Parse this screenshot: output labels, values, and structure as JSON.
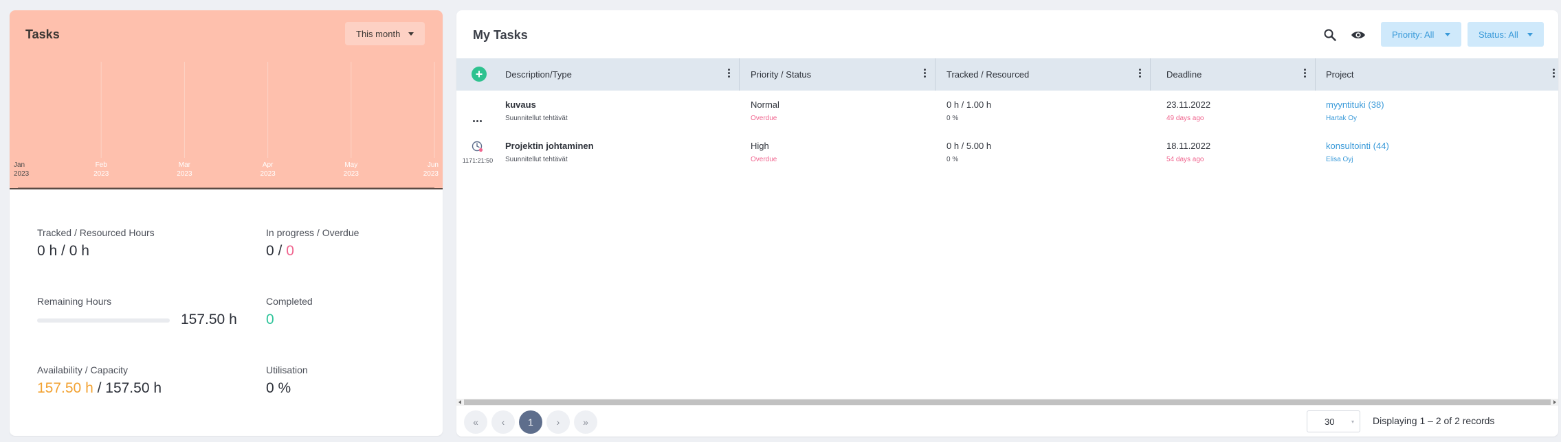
{
  "tasks_card": {
    "title": "Tasks",
    "period": "This month",
    "chart_bg": "#fec0ad",
    "chart_data": {
      "type": "area",
      "x": [
        {
          "month": "Jan",
          "year": "2023"
        },
        {
          "month": "Feb",
          "year": "2023"
        },
        {
          "month": "Mar",
          "year": "2023"
        },
        {
          "month": "Apr",
          "year": "2023"
        },
        {
          "month": "May",
          "year": "2023"
        },
        {
          "month": "Jun",
          "year": "2023"
        }
      ],
      "values": [
        0,
        0,
        0,
        0,
        0,
        0
      ],
      "grid": "vertical"
    },
    "stats": {
      "tracked_label": "Tracked / Resourced Hours",
      "tracked_value": "0 h / 0 h",
      "progress_label": "In progress / Overdue",
      "in_progress": "0",
      "overdue": "0",
      "remaining_label": "Remaining Hours",
      "remaining_value": "157.50 h",
      "remaining_progress": 0,
      "completed_label": "Completed",
      "completed_value": "0",
      "availability_label": "Availability / Capacity",
      "availability_value": "157.50 h",
      "capacity_value": "157.50 h",
      "utilisation_label": "Utilisation",
      "utilisation_value": "0 %"
    }
  },
  "my_tasks": {
    "title": "My Tasks",
    "filters": {
      "priority": "Priority: All",
      "status": "Status: All"
    },
    "columns": [
      "Description/Type",
      "Priority / Status",
      "Tracked / Resourced",
      "Deadline",
      "Project"
    ],
    "rows": [
      {
        "name": "kuvaus",
        "type": "Suunnitellut tehtävät",
        "priority": "Normal",
        "status": "Overdue",
        "tracked": "0 h / 1.00 h",
        "percent": "0 %",
        "deadline": "23.11.2022",
        "deadline_rel": "49 days ago",
        "project": "myyntituki (38)",
        "client": "Hartak Oy"
      },
      {
        "name": "Projektin johtaminen",
        "type": "Suunnitellut tehtävät",
        "timer": "1171:21:50",
        "priority": "High",
        "status": "Overdue",
        "tracked": "0 h / 5.00 h",
        "percent": "0 %",
        "deadline": "18.11.2022",
        "deadline_rel": "54 days ago",
        "project": "konsultointi (44)",
        "client": "Elisa Oyj"
      }
    ],
    "pager": {
      "first": "«",
      "prev": "‹",
      "current": "1",
      "next": "›",
      "last": "»",
      "page_size": "30",
      "records": "Displaying 1 – 2 of 2 records"
    }
  },
  "colors": {
    "accent_blue": "#3a9ad9",
    "overdue_pink": "#f0648e",
    "completed_green": "#2fc49a",
    "availability_orange": "#f2a232",
    "pager_active": "#5e6e8c"
  }
}
